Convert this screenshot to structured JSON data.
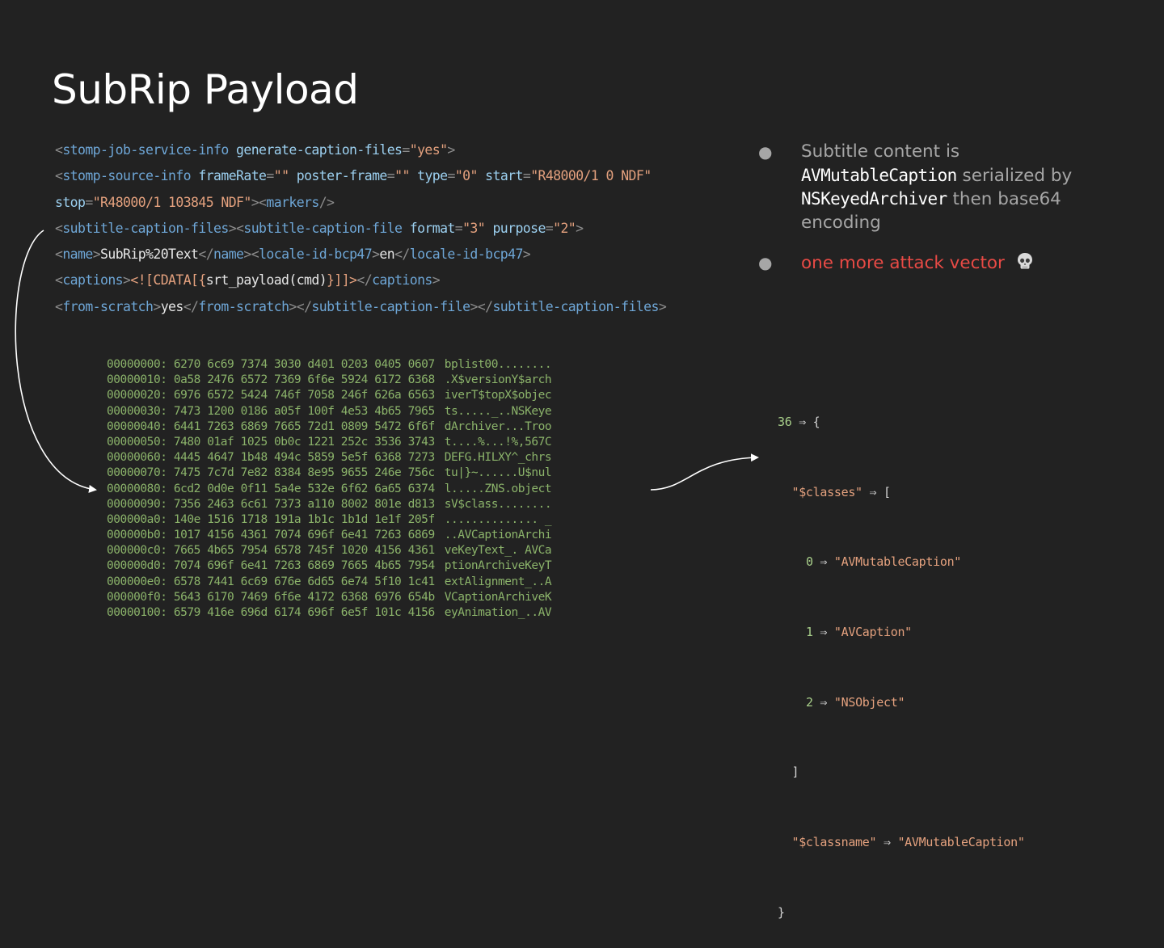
{
  "title": "SubRip Payload",
  "xml_lines": [
    [
      {
        "t": "<",
        "c": "punc"
      },
      {
        "t": "stomp-job-service-info",
        "c": "tag"
      },
      {
        "t": " ",
        "c": "txt"
      },
      {
        "t": "generate-caption-files",
        "c": "attr"
      },
      {
        "t": "=",
        "c": "punc"
      },
      {
        "t": "\"yes\"",
        "c": "str"
      },
      {
        "t": ">",
        "c": "punc"
      }
    ],
    [
      {
        "t": "<",
        "c": "punc"
      },
      {
        "t": "stomp-source-info",
        "c": "tag"
      },
      {
        "t": " ",
        "c": "txt"
      },
      {
        "t": "frameRate",
        "c": "attr"
      },
      {
        "t": "=",
        "c": "punc"
      },
      {
        "t": "\"\"",
        "c": "str"
      },
      {
        "t": " ",
        "c": "txt"
      },
      {
        "t": "poster-frame",
        "c": "attr"
      },
      {
        "t": "=",
        "c": "punc"
      },
      {
        "t": "\"\"",
        "c": "str"
      },
      {
        "t": " ",
        "c": "txt"
      },
      {
        "t": "type",
        "c": "attr"
      },
      {
        "t": "=",
        "c": "punc"
      },
      {
        "t": "\"0\"",
        "c": "str"
      },
      {
        "t": " ",
        "c": "txt"
      },
      {
        "t": "start",
        "c": "attr"
      },
      {
        "t": "=",
        "c": "punc"
      },
      {
        "t": "\"R48000/1 0 NDF\"",
        "c": "str"
      }
    ],
    [
      {
        "t": "stop",
        "c": "attr"
      },
      {
        "t": "=",
        "c": "punc"
      },
      {
        "t": "\"R48000/1 103845 NDF\"",
        "c": "str"
      },
      {
        "t": "><",
        "c": "punc"
      },
      {
        "t": "markers",
        "c": "tag"
      },
      {
        "t": "/>",
        "c": "punc"
      }
    ],
    [
      {
        "t": "<",
        "c": "punc"
      },
      {
        "t": "subtitle-caption-files",
        "c": "tag"
      },
      {
        "t": "><",
        "c": "punc"
      },
      {
        "t": "subtitle-caption-file",
        "c": "tag"
      },
      {
        "t": " ",
        "c": "txt"
      },
      {
        "t": "format",
        "c": "attr"
      },
      {
        "t": "=",
        "c": "punc"
      },
      {
        "t": "\"3\"",
        "c": "str"
      },
      {
        "t": " ",
        "c": "txt"
      },
      {
        "t": "purpose",
        "c": "attr"
      },
      {
        "t": "=",
        "c": "punc"
      },
      {
        "t": "\"2\"",
        "c": "str"
      },
      {
        "t": ">",
        "c": "punc"
      }
    ],
    [
      {
        "t": "<",
        "c": "punc"
      },
      {
        "t": "name",
        "c": "tag"
      },
      {
        "t": ">",
        "c": "punc"
      },
      {
        "t": "SubRip%20Text",
        "c": "txt"
      },
      {
        "t": "</",
        "c": "punc"
      },
      {
        "t": "name",
        "c": "tag"
      },
      {
        "t": "><",
        "c": "punc"
      },
      {
        "t": "locale-id-bcp47",
        "c": "tag"
      },
      {
        "t": ">",
        "c": "punc"
      },
      {
        "t": "en",
        "c": "txt"
      },
      {
        "t": "</",
        "c": "punc"
      },
      {
        "t": "locale-id-bcp47",
        "c": "tag"
      },
      {
        "t": ">",
        "c": "punc"
      }
    ],
    [
      {
        "t": "<",
        "c": "punc"
      },
      {
        "t": "captions",
        "c": "tag"
      },
      {
        "t": ">",
        "c": "punc"
      },
      {
        "t": "<![CDATA[{",
        "c": "cdata"
      },
      {
        "t": "srt_payload(cmd)",
        "c": "txt"
      },
      {
        "t": "}]]>",
        "c": "cdata"
      },
      {
        "t": "</",
        "c": "punc"
      },
      {
        "t": "captions",
        "c": "tag"
      },
      {
        "t": ">",
        "c": "punc"
      }
    ],
    [
      {
        "t": "<",
        "c": "punc"
      },
      {
        "t": "from-scratch",
        "c": "tag"
      },
      {
        "t": ">",
        "c": "punc"
      },
      {
        "t": "yes",
        "c": "txt"
      },
      {
        "t": "</",
        "c": "punc"
      },
      {
        "t": "from-scratch",
        "c": "tag"
      },
      {
        "t": "></",
        "c": "punc"
      },
      {
        "t": "subtitle-caption-file",
        "c": "tag"
      },
      {
        "t": "></",
        "c": "punc"
      },
      {
        "t": "subtitle-caption-files",
        "c": "tag"
      },
      {
        "t": ">",
        "c": "punc"
      }
    ]
  ],
  "hexdump": [
    {
      "offset": "00000000:",
      "bytes": "6270 6c69 7374 3030 d401 0203 0405 0607",
      "ascii": "bplist00........"
    },
    {
      "offset": "00000010:",
      "bytes": "0a58 2476 6572 7369 6f6e 5924 6172 6368",
      "ascii": ".X$versionY$arch"
    },
    {
      "offset": "00000020:",
      "bytes": "6976 6572 5424 746f 7058 246f 626a 6563",
      "ascii": "iverT$topX$objec"
    },
    {
      "offset": "00000030:",
      "bytes": "7473 1200 0186 a05f 100f 4e53 4b65 7965",
      "ascii": "ts....._..NSKeye"
    },
    {
      "offset": "00000040:",
      "bytes": "6441 7263 6869 7665 72d1 0809 5472 6f6f",
      "ascii": "dArchiver...Troo"
    },
    {
      "offset": "00000050:",
      "bytes": "7480 01af 1025 0b0c 1221 252c 3536 3743",
      "ascii": "t....%...!%,567C"
    },
    {
      "offset": "00000060:",
      "bytes": "4445 4647 1b48 494c 5859 5e5f 6368 7273",
      "ascii": "DEFG.HILXY^_chrs"
    },
    {
      "offset": "00000070:",
      "bytes": "7475 7c7d 7e82 8384 8e95 9655 246e 756c",
      "ascii": "tu|}~......U$nul"
    },
    {
      "offset": "00000080:",
      "bytes": "6cd2 0d0e 0f11 5a4e 532e 6f62 6a65 6374",
      "ascii": "l.....ZNS.object"
    },
    {
      "offset": "00000090:",
      "bytes": "7356 2463 6c61 7373 a110 8002 801e d813",
      "ascii": "sV$class........"
    },
    {
      "offset": "000000a0:",
      "bytes": "140e 1516 1718 191a 1b1c 1b1d 1e1f 205f",
      "ascii": ".............. _"
    },
    {
      "offset": "000000b0:",
      "bytes": "1017 4156 4361 7074 696f 6e41 7263 6869",
      "ascii": "..AVCaptionArchi"
    },
    {
      "offset": "000000c0:",
      "bytes": "7665 4b65 7954 6578 745f 1020 4156 4361",
      "ascii": "veKeyText_. AVCa"
    },
    {
      "offset": "000000d0:",
      "bytes": "7074 696f 6e41 7263 6869 7665 4b65 7954",
      "ascii": "ptionArchiveKeyT"
    },
    {
      "offset": "000000e0:",
      "bytes": "6578 7441 6c69 676e 6d65 6e74 5f10 1c41",
      "ascii": "extAlignment_..A"
    },
    {
      "offset": "000000f0:",
      "bytes": "5643 6170 7469 6f6e 4172 6368 6976 654b",
      "ascii": "VCaptionArchiveK"
    },
    {
      "offset": "00000100:",
      "bytes": "6579 416e 696d 6174 696f 6e5f 101c 4156",
      "ascii": "eyAnimation_..AV"
    }
  ],
  "bullets": {
    "b1_text_1": "Subtitle content is",
    "b1_code_1": "AVMutableCaption",
    "b1_text_2": " serialized by",
    "b1_code_2": "NSKeyedArchiver",
    "b1_text_3": " then base64 encoding",
    "b2_text": "one more attack vector"
  },
  "object_dump": {
    "l1_num": "36",
    "l1_rest": " ⇒ {",
    "l2_key": "\"$classes\"",
    "l2_rest": " ⇒ [",
    "items": [
      {
        "index": "0",
        "arrow": " ⇒ ",
        "value": "\"AVMutableCaption\""
      },
      {
        "index": "1",
        "arrow": " ⇒ ",
        "value": "\"AVCaption\""
      },
      {
        "index": "2",
        "arrow": " ⇒ ",
        "value": "\"NSObject\""
      }
    ],
    "l6": "]",
    "l7_key": "\"$classname\"",
    "l7_arrow": " ⇒ ",
    "l7_value": "\"AVMutableCaption\"",
    "l8": "}"
  },
  "colors": {
    "background": "#222222",
    "tag": "#6ea6d6",
    "attribute": "#9cd0f0",
    "string": "#e4a17e",
    "hex": "#8bb36a",
    "alert": "#e84a45"
  },
  "icons": [
    "skull-icon",
    "bullet-dot-icon",
    "arrow-icon"
  ]
}
